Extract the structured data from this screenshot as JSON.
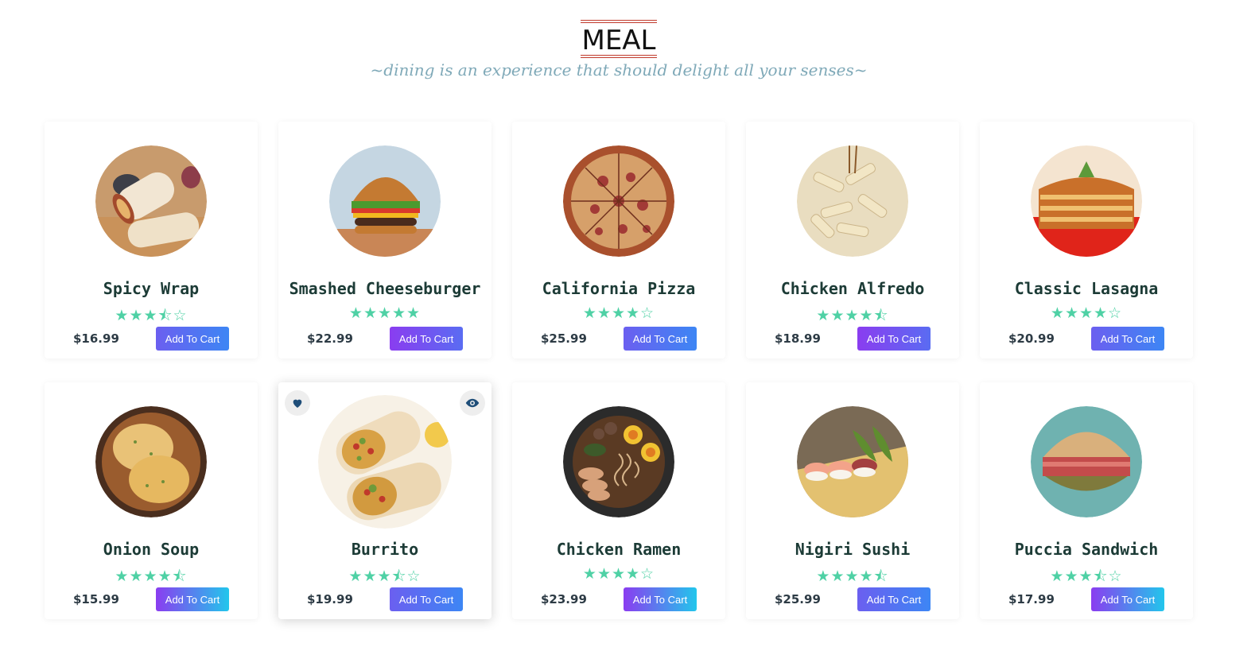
{
  "header": {
    "title": "MEAL",
    "subtitle": "~dining is an experience that should delight all your senses~"
  },
  "colors": {
    "accent_line": "#c0392b",
    "star": "#4fd1a5",
    "btn_blue": "#5a6cf2",
    "btn_purple": "#8a3df0",
    "btn_cyan": "#22c6ec"
  },
  "items": [
    {
      "name": "Spicy Wrap",
      "price": "$16.99",
      "rating": 3.5,
      "stars": "★★★⯪☆",
      "button": "Add To Cart",
      "icon": "wrap-image",
      "btn": "blue"
    },
    {
      "name": "Smashed Cheeseburger",
      "price": "$22.99",
      "rating": 5,
      "stars": "★★★★★",
      "button": "Add To Cart",
      "icon": "burger-image",
      "btn": "purple"
    },
    {
      "name": "California Pizza",
      "price": "$25.99",
      "rating": 4,
      "stars": "★★★★☆",
      "button": "Add To Cart",
      "icon": "pizza-image",
      "btn": "blue"
    },
    {
      "name": "Chicken Alfredo",
      "price": "$18.99",
      "rating": 4.5,
      "stars": "★★★★⯪",
      "button": "Add To Cart",
      "icon": "pasta-image",
      "btn": "purple"
    },
    {
      "name": "Classic Lasagna",
      "price": "$20.99",
      "rating": 4,
      "stars": "★★★★☆",
      "button": "Add To Cart",
      "icon": "lasagna-image",
      "btn": "blue"
    },
    {
      "name": "Onion Soup",
      "price": "$15.99",
      "rating": 4.5,
      "stars": "★★★★⯪",
      "button": "Add To Cart",
      "icon": "soup-image",
      "btn": "purple"
    },
    {
      "name": "Burrito",
      "price": "$19.99",
      "rating": 3.5,
      "stars": "★★★⯪☆",
      "button": "Add To Cart",
      "icon": "burrito-image",
      "btn": "blue"
    },
    {
      "name": "Chicken Ramen",
      "price": "$23.99",
      "rating": 4,
      "stars": "★★★★☆",
      "button": "Add To Cart",
      "icon": "ramen-image",
      "btn": "purple"
    },
    {
      "name": "Nigiri Sushi",
      "price": "$25.99",
      "rating": 4.5,
      "stars": "★★★★⯪",
      "button": "Add To Cart",
      "icon": "sushi-image",
      "btn": "blue"
    },
    {
      "name": "Puccia Sandwich",
      "price": "$17.99",
      "rating": 3.5,
      "stars": "★★★⯪☆",
      "button": "Add To Cart",
      "icon": "sandwich-image",
      "btn": "purple"
    }
  ]
}
